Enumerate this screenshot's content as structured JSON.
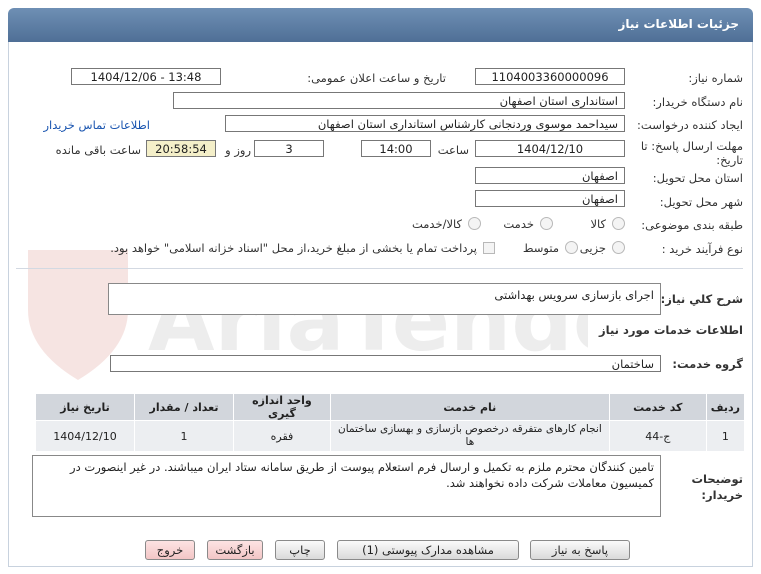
{
  "page": {
    "title": "جزئیات اطلاعات نیاز"
  },
  "watermark": "AriaTender.neT",
  "form": {
    "need_number_label": "شماره نیاز:",
    "need_number": "1104003360000096",
    "announce_label": "تاریخ و ساعت اعلان عمومی:",
    "announce_value": "1404/12/06 - 13:48",
    "buyer_org_label": "نام دستگاه خریدار:",
    "buyer_org": "استانداری استان اصفهان",
    "creator_label": "ایجاد کننده درخواست:",
    "creator": "سیداحمد موسوی وردنجانی کارشناس استانداری استان اصفهان",
    "contact_link": "اطلاعات تماس خریدار",
    "deadline_label_1": "مهلت ارسال پاسخ: تا",
    "deadline_label_2": "تاریخ:",
    "deadline_date": "1404/12/10",
    "time_label": "ساعت",
    "deadline_time": "14:00",
    "days_value": "3",
    "days_label": "روز و",
    "remaining_time": "20:58:54",
    "remaining_label": "ساعت باقی مانده",
    "province_label": "استان محل تحویل:",
    "province": "اصفهان",
    "city_label": "شهر محل تحویل:",
    "city": "اصفهان",
    "category_label": "طبقه بندی موضوعی:",
    "category_options": [
      "کالا",
      "خدمت",
      "کالا/خدمت"
    ],
    "purchase_type_label": "نوع فرآیند خرید :",
    "purchase_options": [
      "جزیی",
      "متوسط"
    ],
    "payment_note": "پرداخت تمام یا بخشی از مبلغ خرید،از محل \"اسناد خزانه اسلامی\" خواهد بود."
  },
  "summary": {
    "label": "شرح کلي نياز:",
    "value": "اجرای بازسازی سرویس بهداشتی"
  },
  "services": {
    "section_title": "اطلاعات خدمات مورد نیاز",
    "group_label": "گروه خدمت:",
    "group_value": "ساختمان",
    "columns": [
      "ردیف",
      "کد خدمت",
      "نام خدمت",
      "واحد اندازه گیری",
      "تعداد / مقدار",
      "تاریخ نیاز"
    ],
    "rows": [
      {
        "row": "1",
        "code": "ج-44",
        "name": "انجام کارهای متفرقه درخصوص بازسازی و بهسازی ساختمان ها",
        "unit": "فقره",
        "qty": "1",
        "date": "1404/12/10"
      }
    ]
  },
  "notes": {
    "label_1": "توضیحات",
    "label_2": "خریدار:",
    "text": "تامین کنندگان محترم ملزم به تکمیل و ارسال فرم استعلام پیوست از طریق سامانه ستاد ایران میباشند. در غیر اینصورت در کمیسیون معاملات شرکت داده نخواهند شد."
  },
  "buttons": {
    "reply": "پاسخ به نیاز",
    "attachments": "مشاهده مدارک پیوستی (1)",
    "print": "چاپ",
    "back": "بازگشت",
    "exit": "خروج"
  },
  "colors": {
    "title_bar": "#5a7aa1",
    "highlight": "#f4efc9",
    "link": "#1a55b0",
    "table_header": "#d2d6dc"
  }
}
